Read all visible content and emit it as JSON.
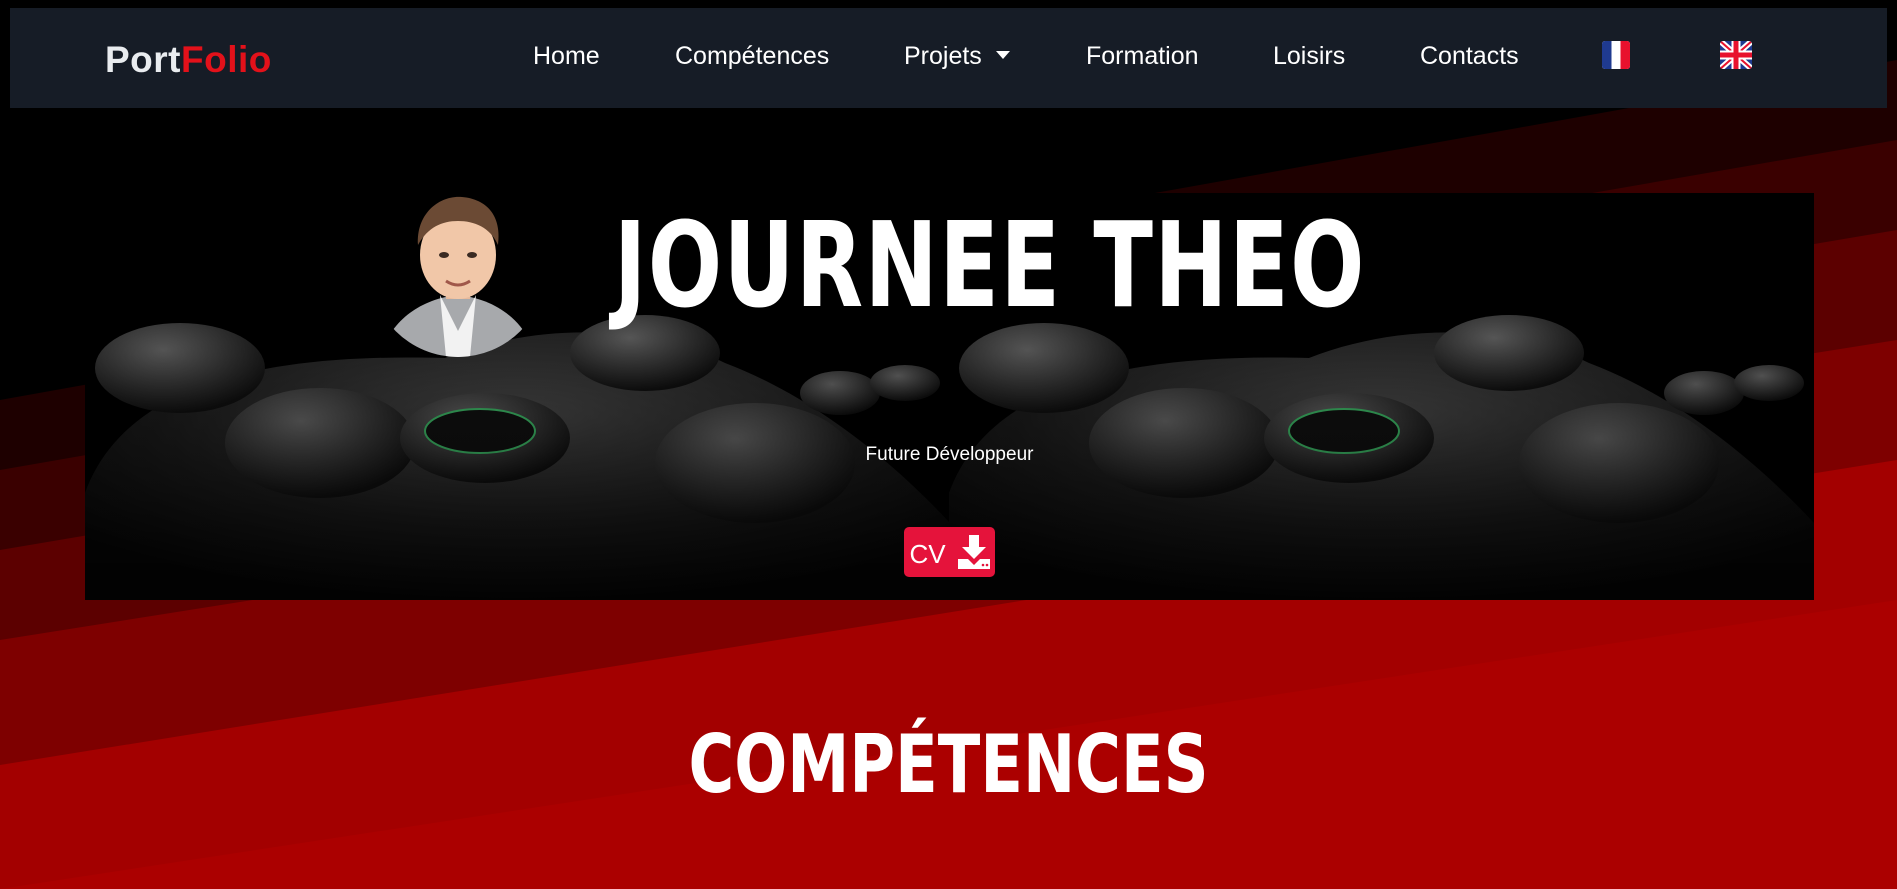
{
  "brand": {
    "part1": "Port",
    "part2": "Folio"
  },
  "nav": {
    "items": [
      {
        "label": "Home"
      },
      {
        "label": "Compétences"
      },
      {
        "label": "Projets"
      },
      {
        "label": "Formation"
      },
      {
        "label": "Loisirs"
      },
      {
        "label": "Contacts"
      }
    ],
    "languages": [
      "french-flag-icon",
      "uk-flag-icon"
    ]
  },
  "hero": {
    "name": "JOURNEE THEO",
    "subtitle": "Future Développeur",
    "cv_label": "CV",
    "cv_icon": "download-icon"
  },
  "section": {
    "title": "COMPÉTENCES"
  },
  "colors": {
    "navbar": "#161c26",
    "brand_accent": "#e3111a",
    "cv_button": "#e5133b",
    "bg_red": "#a80000"
  }
}
